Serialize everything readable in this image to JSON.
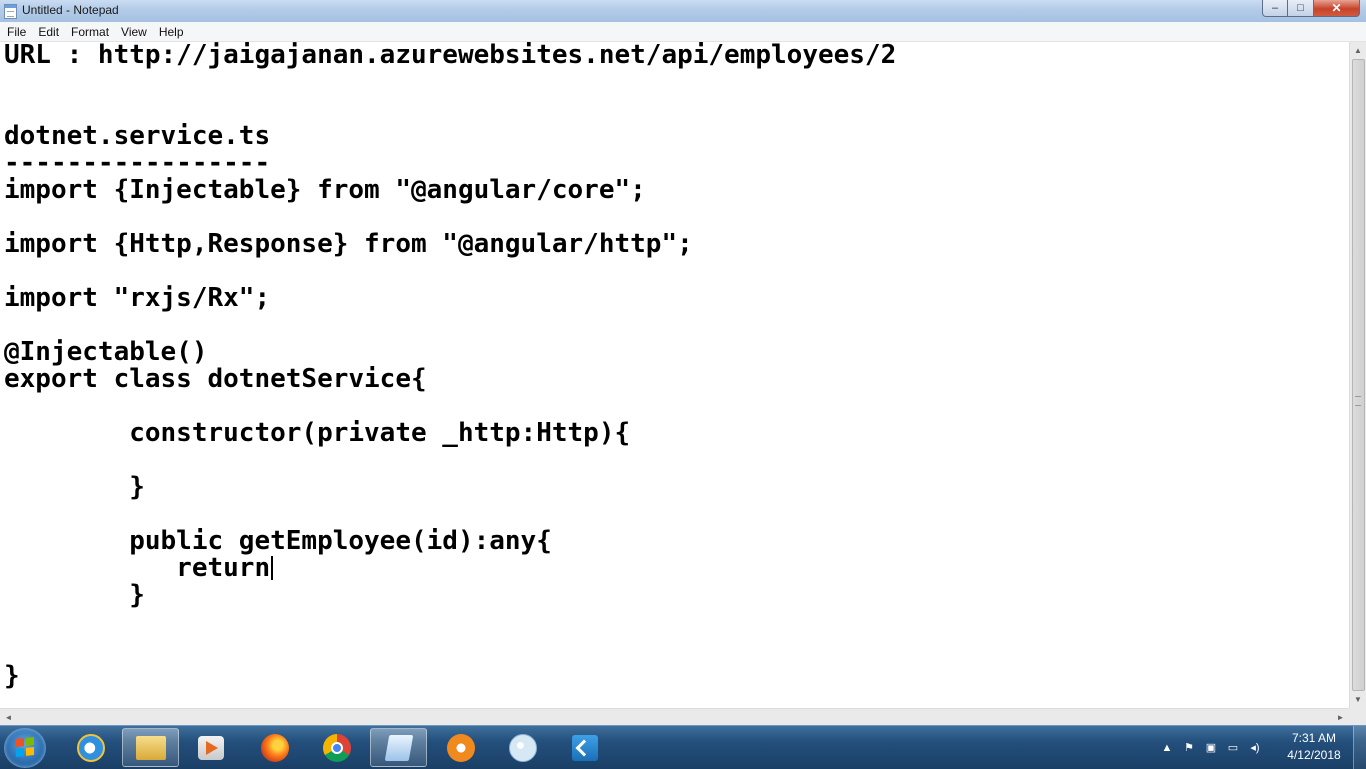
{
  "window": {
    "title": "Untitled - Notepad",
    "buttons": {
      "minimize": "–",
      "maximize": "□",
      "close": "✕"
    }
  },
  "menu": {
    "items": [
      "File",
      "Edit",
      "Format",
      "View",
      "Help"
    ]
  },
  "editor": {
    "lines": [
      "URL : http://jaigajanan.azurewebsites.net/api/employees/2",
      "",
      "",
      "dotnet.service.ts",
      "-----------------",
      "import {Injectable} from \"@angular/core\";",
      "",
      "import {Http,Response} from \"@angular/http\";",
      "",
      "import \"rxjs/Rx\";",
      "",
      "@Injectable()",
      "export class dotnetService{",
      "",
      "        constructor(private _http:Http){",
      "",
      "        }",
      "",
      "        public getEmployee(id):any{",
      "           return ",
      "        }",
      "",
      "",
      "}"
    ],
    "caret_line": 19
  },
  "scrollbars": {
    "up": "▲",
    "down": "▼",
    "left": "◄",
    "right": "►"
  },
  "taskbar": {
    "apps": [
      {
        "name": "internet-explorer-icon",
        "active": false
      },
      {
        "name": "file-explorer-icon",
        "active": true
      },
      {
        "name": "media-player-icon",
        "active": false
      },
      {
        "name": "firefox-icon",
        "active": false
      },
      {
        "name": "chrome-icon",
        "active": false
      },
      {
        "name": "notepad-icon",
        "active": true
      },
      {
        "name": "flower-app-icon",
        "active": false
      },
      {
        "name": "paint-icon",
        "active": false
      },
      {
        "name": "vscode-icon",
        "active": false
      }
    ],
    "tray": {
      "show_hidden": "▲",
      "flag": "⚑",
      "network": "▣",
      "display": "▭",
      "volume": "◂)"
    },
    "clock": {
      "time": "7:31 AM",
      "date": "4/12/2018"
    }
  }
}
